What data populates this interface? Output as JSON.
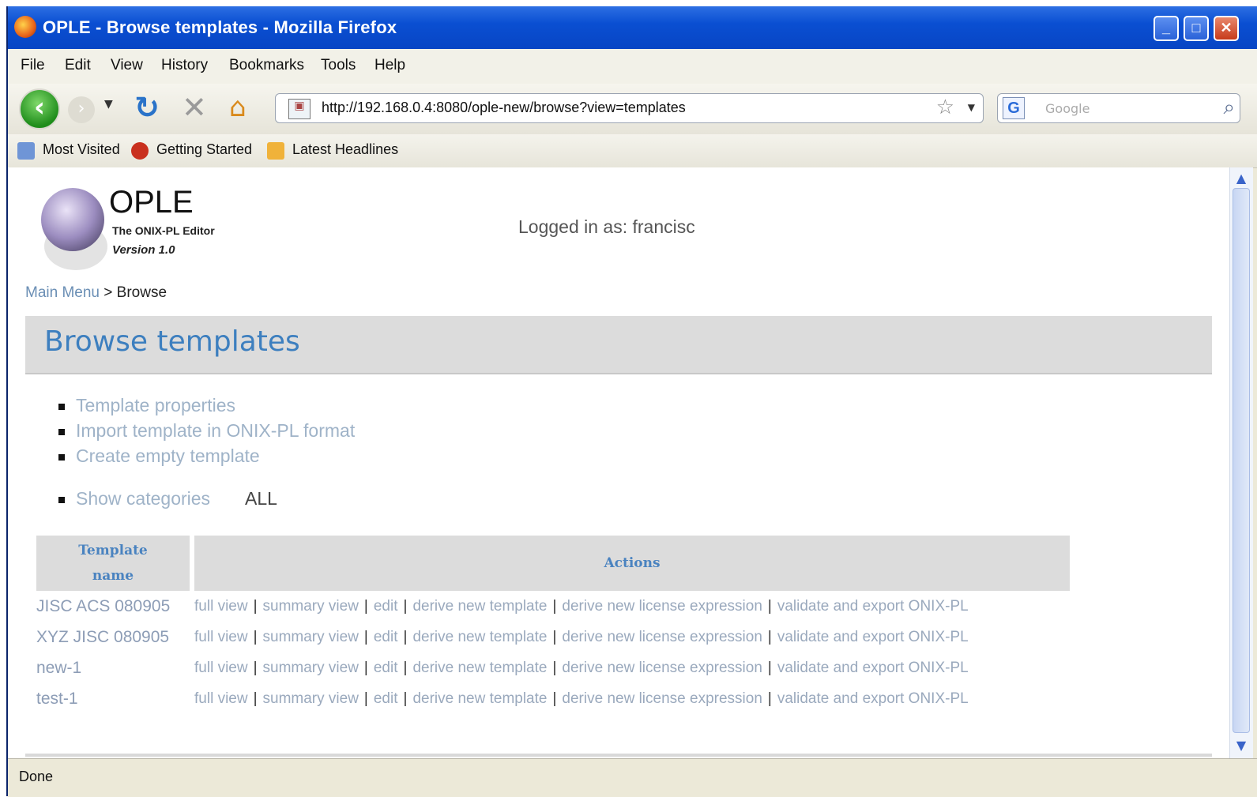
{
  "window": {
    "title": "OPLE - Browse templates - Mozilla Firefox",
    "controls": [
      "_",
      "□",
      "✕"
    ]
  },
  "menu": [
    "File",
    "Edit",
    "View",
    "History",
    "Bookmarks",
    "Tools",
    "Help"
  ],
  "nav": {
    "url": "http://192.168.0.4:8080/ople-new/browse?view=templates",
    "search_placeholder": "Google"
  },
  "bookmarks": [
    "Most Visited",
    "Getting Started",
    "Latest Headlines"
  ],
  "logo": {
    "title": "OPLE",
    "subtitle": "The ONIX-PL Editor",
    "version": "Version 1.0"
  },
  "login_text": "Logged in as: francisc",
  "breadcrumb": {
    "link": "Main Menu",
    "sep": " > ",
    "current": "Browse"
  },
  "heading": "Browse templates",
  "links": [
    "Template properties",
    "Import template in ONIX-PL format",
    "Create empty template"
  ],
  "categories": {
    "link": "Show categories",
    "value": "ALL"
  },
  "table": {
    "headers": {
      "name_line1": "Template",
      "name_line2": "name",
      "actions": "Actions"
    },
    "actions": [
      "full view",
      "summary view",
      "edit",
      "derive new template",
      "derive new license expression",
      "validate and export ONIX-PL"
    ],
    "rows": [
      "JISC ACS 080905",
      "XYZ JISC 080905",
      "new-1",
      "test-1"
    ]
  },
  "status": "Done"
}
